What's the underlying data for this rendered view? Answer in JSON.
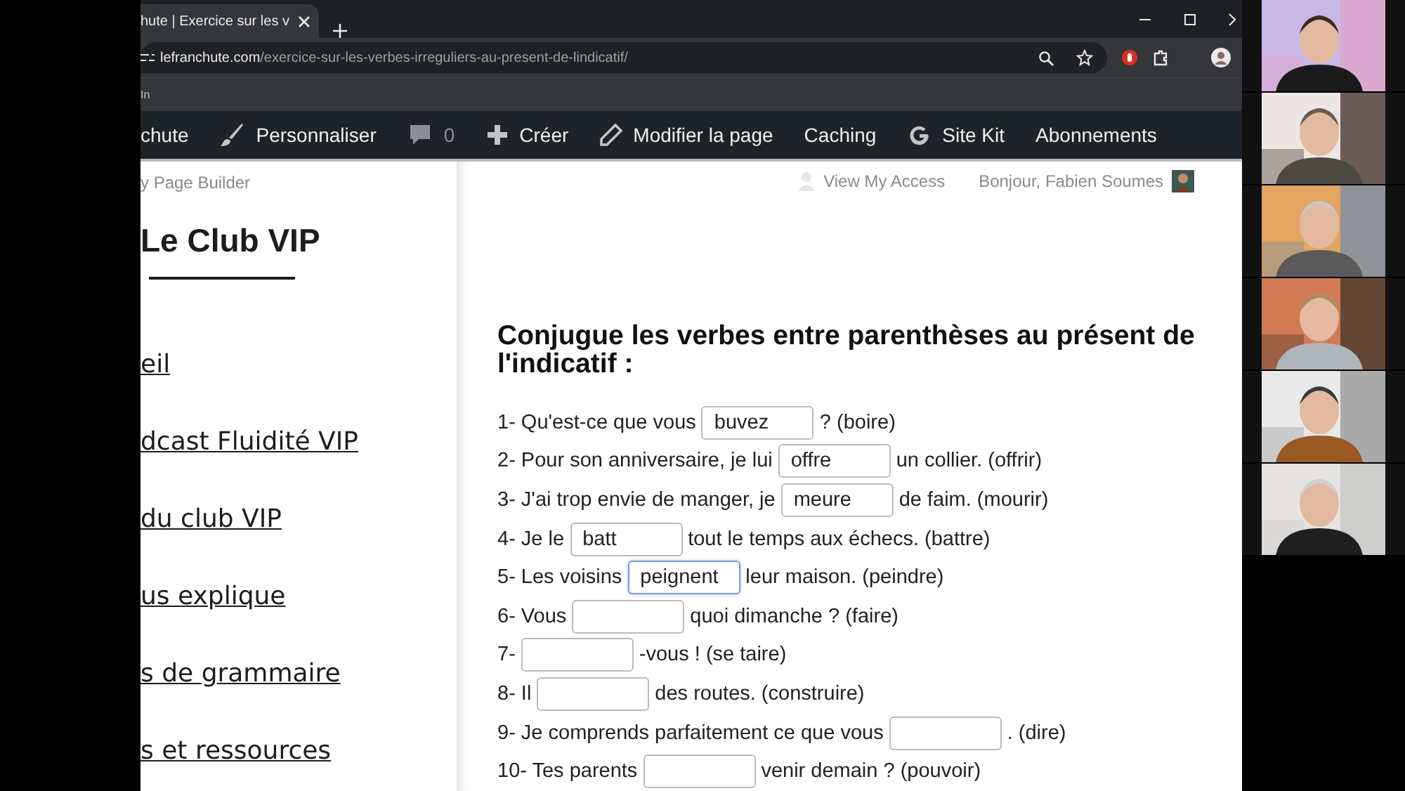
{
  "browser": {
    "tab_title": "hute | Exercice sur les v",
    "url_domain": "lefranchute.com",
    "url_path": "/exercice-sur-les-verbes-irreguliers-au-present-de-lindicatif/",
    "bookmark": "In"
  },
  "admin_bar": {
    "items": [
      {
        "kind": "text",
        "label": "chute"
      },
      {
        "kind": "brush",
        "label": "Personnaliser"
      },
      {
        "kind": "comment",
        "label": "0"
      },
      {
        "kind": "plus",
        "label": "Créer"
      },
      {
        "kind": "pencil",
        "label": "Modifier la page"
      },
      {
        "kind": "text",
        "label": "Caching"
      },
      {
        "kind": "google",
        "label": "Site Kit"
      },
      {
        "kind": "text",
        "label": "Abonnements"
      }
    ]
  },
  "top_strip": {
    "left": "y Page Builder",
    "access": "View My Access",
    "greeting": "Bonjour, Fabien Soumes"
  },
  "sidebar": {
    "title": "Le Club VIP",
    "links": [
      "eil",
      "dcast Fluidité VIP",
      "du club VIP",
      "us explique",
      "s de grammaire",
      "s et ressources"
    ]
  },
  "exercise": {
    "heading": "Conjugue les verbes entre parenthèses au présent de l'indicatif :",
    "items": [
      {
        "before": "1- Qu'est-ce que vous",
        "value": "buvez",
        "after": "? (boire)",
        "focused": false
      },
      {
        "before": "2- Pour son anniversaire, je lui",
        "value": "offre",
        "after": "un collier. (offrir)",
        "focused": false
      },
      {
        "before": "3- J'ai trop envie de manger, je",
        "value": "meure",
        "after": "de faim. (mourir)",
        "focused": false
      },
      {
        "before": "4- Je le",
        "value": "batt",
        "after": "tout le temps aux échecs. (battre)",
        "focused": false
      },
      {
        "before": "5- Les voisins",
        "value": "peignent",
        "after": "leur maison. (peindre)",
        "focused": true
      },
      {
        "before": "6- Vous",
        "after": "quoi dimanche ? (faire)",
        "focused": false
      },
      {
        "before": "7-",
        "after": "-vous ! (se taire)",
        "focused": false
      },
      {
        "before": "8- Il",
        "after": "des routes. (construire)",
        "focused": false
      },
      {
        "before": "9- Je comprends parfaitement ce que vous",
        "after": ". (dire)",
        "focused": false
      },
      {
        "before": "10- Tes parents",
        "after": "venir demain ? (pouvoir)",
        "focused": false
      }
    ]
  }
}
